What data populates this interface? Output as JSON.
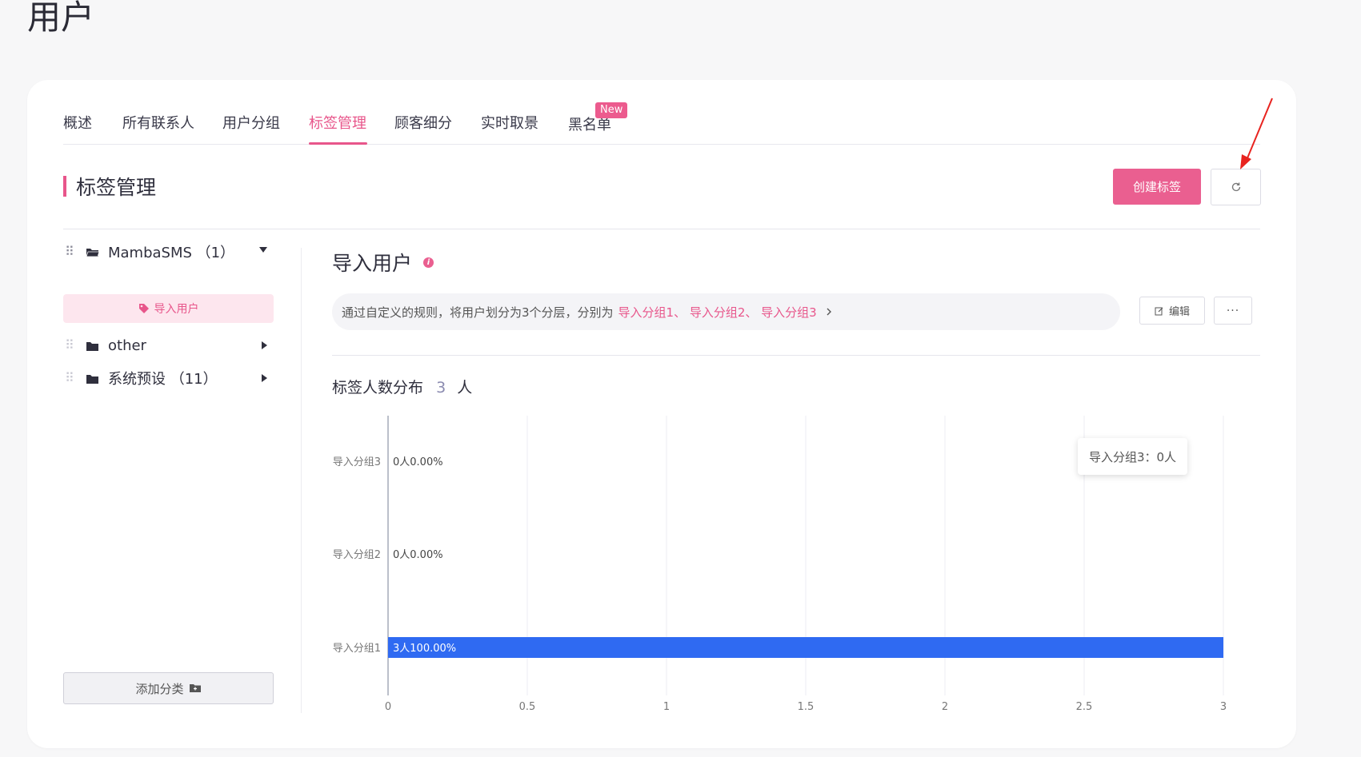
{
  "page": {
    "title": "用户"
  },
  "tabs": [
    {
      "label": "概述"
    },
    {
      "label": "所有联系人"
    },
    {
      "label": "用户分组"
    },
    {
      "label": "标签管理",
      "active": true
    },
    {
      "label": "顾客细分"
    },
    {
      "label": "实时取景"
    },
    {
      "label": "黑名单",
      "badge": "New"
    }
  ],
  "section": {
    "title": "标签管理",
    "create_button": "创建标签",
    "refresh_icon": "refresh-icon"
  },
  "sidebar": {
    "folders": [
      {
        "name": "MambaSMS （1）",
        "expanded": true,
        "tags": [
          {
            "label": "导入用户"
          }
        ]
      },
      {
        "name": "other",
        "expanded": false
      },
      {
        "name": "系统预设 （11）",
        "expanded": false
      }
    ],
    "add_button": "添加分类"
  },
  "detail": {
    "title": "导入用户",
    "description": "通过自定义的规则，将用户划分为3个分层，分别为",
    "links": "导入分组1、 导入分组2、 导入分组3",
    "edit_button": "编辑",
    "more_button": "···",
    "distribution_label": "标签人数分布",
    "distribution_count": "3",
    "distribution_unit": "人"
  },
  "tooltip": {
    "text": "导入分组3：0人"
  },
  "colors": {
    "accent": "#e8568b",
    "bar": "#2f6af2"
  },
  "chart_data": {
    "type": "bar",
    "orientation": "horizontal",
    "categories": [
      "导入分组3",
      "导入分组2",
      "导入分组1"
    ],
    "values": [
      0,
      0,
      3
    ],
    "data_labels": [
      "0人0.00%",
      "0人0.00%",
      "3人100.00%"
    ],
    "xticks": [
      "0",
      "0.5",
      "1",
      "1.5",
      "2",
      "2.5",
      "3"
    ],
    "xlim": [
      0,
      3
    ],
    "grid": true
  }
}
